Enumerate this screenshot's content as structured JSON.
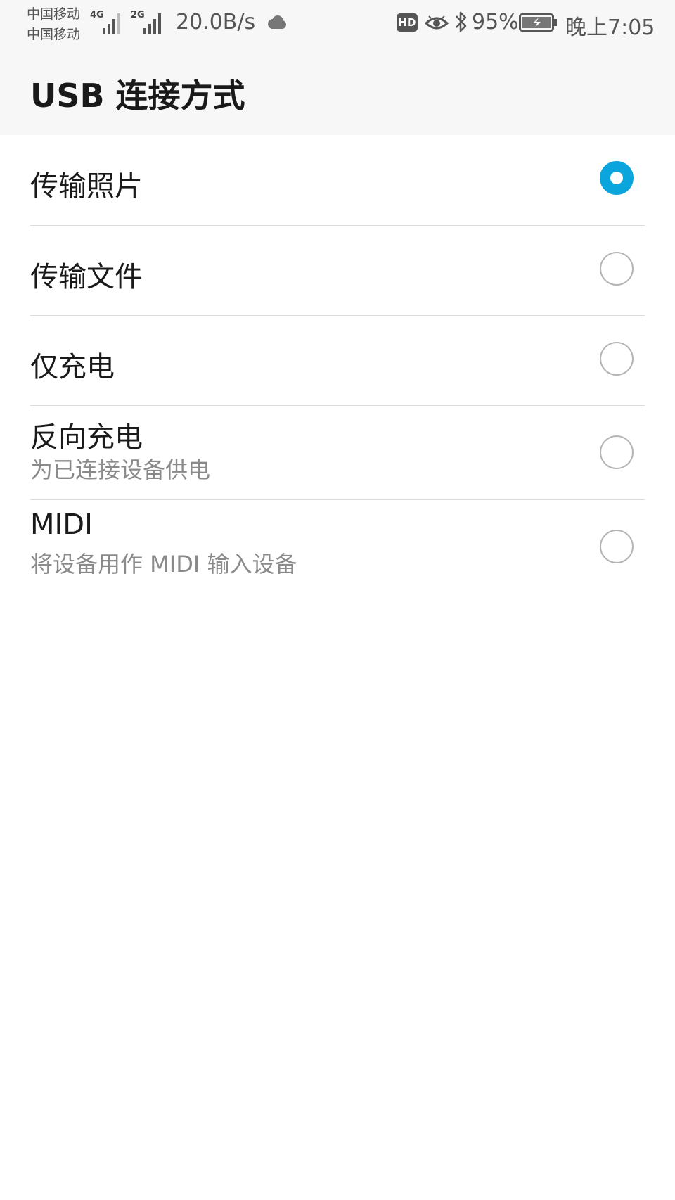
{
  "status_bar": {
    "carrier_1": "中国移动",
    "carrier_2": "中国移动",
    "signal_1_label": "4G",
    "signal_2_label": "2G",
    "network_speed": "20.0B/s",
    "hd_label": "HD",
    "battery_percent": "95%",
    "time": "晚上7:05",
    "icons": [
      "signal-icon",
      "cloud-icon",
      "hd-icon",
      "eye-icon",
      "bluetooth-icon",
      "battery-charging-icon"
    ]
  },
  "header": {
    "title": "USB 连接方式"
  },
  "options": [
    {
      "title": "传输照片",
      "subtitle": "",
      "selected": true
    },
    {
      "title": "传输文件",
      "subtitle": "",
      "selected": false
    },
    {
      "title": "仅充电",
      "subtitle": "",
      "selected": false
    },
    {
      "title": "反向充电",
      "subtitle": "为已连接设备供电",
      "selected": false
    },
    {
      "title": "MIDI",
      "subtitle": "将设备用作 MIDI 输入设备",
      "selected": false
    }
  ],
  "colors": {
    "accent": "#0aa5dc",
    "header_bg": "#f7f7f7",
    "divider": "#dcdcdc",
    "radio_off": "#b4b4b4",
    "subtitle": "#8a8a8a"
  }
}
